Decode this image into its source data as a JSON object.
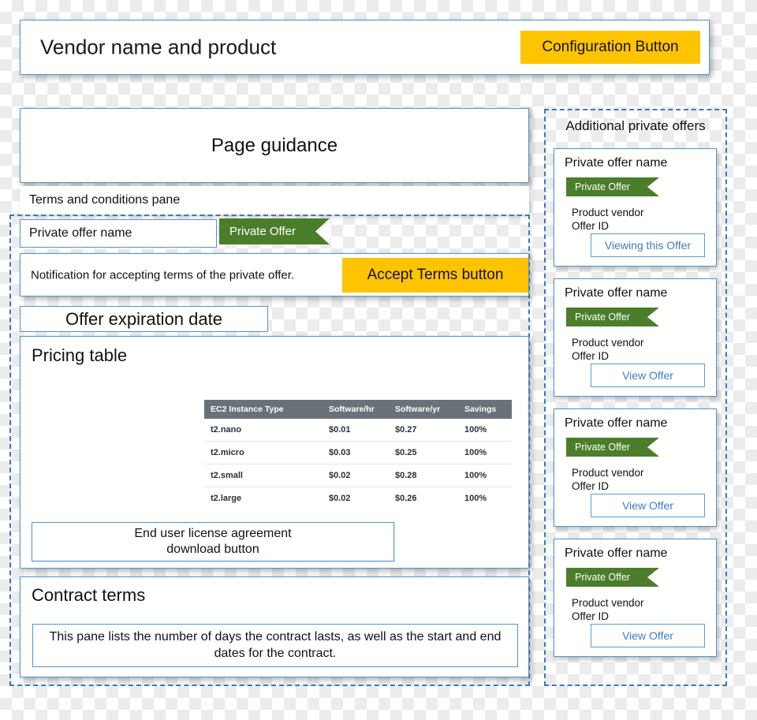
{
  "header": {
    "title": "Vendor name and product",
    "config_button": "Configuration Button"
  },
  "guidance": {
    "text": "Page guidance"
  },
  "terms_pane": {
    "label": "Terms and conditions pane"
  },
  "offer": {
    "name": "Private offer name",
    "badge": "Private Offer",
    "notification": "Notification for accepting terms of the private offer.",
    "accept_button": "Accept Terms button",
    "expiration": "Offer expiration date"
  },
  "pricing": {
    "title": "Pricing table",
    "eula_line1": "End user license agreement",
    "eula_line2": "download button"
  },
  "contract": {
    "title": "Contract terms",
    "note": "This pane lists the number of days the contract lasts, as well as the start and end dates for the contract."
  },
  "sidebar": {
    "title": "Additional private offers",
    "cards": [
      {
        "name": "Private offer name",
        "badge": "Private Offer",
        "vendor": "Product vendor",
        "offer_id": "Offer ID",
        "action": "Viewing this Offer"
      },
      {
        "name": "Private offer name",
        "badge": "Private Offer",
        "vendor": "Product vendor",
        "offer_id": "Offer ID",
        "action": "View Offer"
      },
      {
        "name": "Private offer name",
        "badge": "Private Offer",
        "vendor": "Product vendor",
        "offer_id": "Offer ID",
        "action": "View Offer"
      },
      {
        "name": "Private offer name",
        "badge": "Private Offer",
        "vendor": "Product vendor",
        "offer_id": "Offer ID",
        "action": "View Offer"
      }
    ]
  },
  "colors": {
    "accent_yellow": "#ffc400",
    "badge_green": "#4b7e2b",
    "panel_border_blue": "#4f95d1",
    "dashed_blue": "#3a78c0",
    "table_header_gray": "#697279",
    "link_blue": "#3d7cc9"
  },
  "chart_data": {
    "type": "table",
    "title": "Pricing table",
    "columns": [
      "EC2 Instance Type",
      "Software/hr",
      "Software/yr",
      "Savings"
    ],
    "rows": [
      [
        "t2.nano",
        "$0.01",
        "$0.27",
        "100%"
      ],
      [
        "t2.micro",
        "$0.03",
        "$0.25",
        "100%"
      ],
      [
        "t2.small",
        "$0.02",
        "$0.28",
        "100%"
      ],
      [
        "t2.large",
        "$0.02",
        "$0.26",
        "100%"
      ]
    ]
  }
}
